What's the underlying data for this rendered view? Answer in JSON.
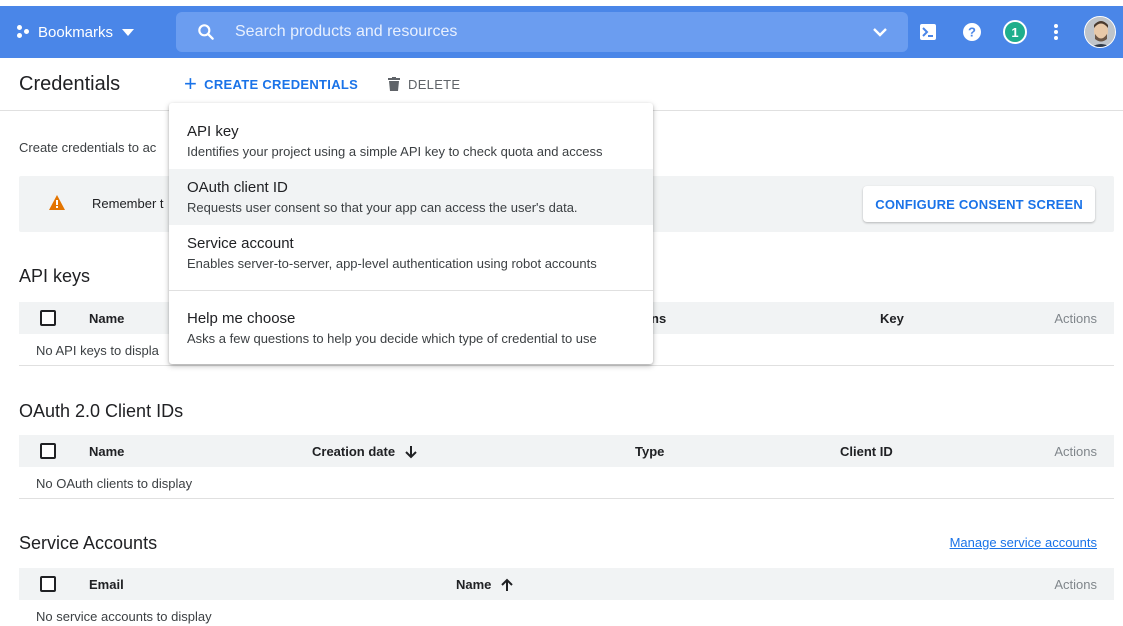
{
  "topbar": {
    "bookmarks_label": "Bookmarks",
    "search_placeholder": "Search products and resources",
    "notification_count": "1",
    "brand_color": "#4a86e8"
  },
  "page": {
    "title": "Credentials",
    "create_label": "CREATE CREDENTIALS",
    "delete_label": "DELETE",
    "intro_text": "Create credentials to ac",
    "notice_text": "Remember t",
    "consent_button": "CONFIGURE CONSENT SCREEN"
  },
  "menu": {
    "items": [
      {
        "title": "API key",
        "description": "Identifies your project using a simple API key to check quota and access"
      },
      {
        "title": "OAuth client ID",
        "description": "Requests user consent so that your app can access the user's data."
      },
      {
        "title": "Service account",
        "description": "Enables server-to-server, app-level authentication using robot accounts"
      },
      {
        "title": "Help me choose",
        "description": "Asks a few questions to help you decide which type of credential to use"
      }
    ]
  },
  "api_keys": {
    "title": "API keys",
    "columns": {
      "name": "Name",
      "restrictions_partial": "ns",
      "key": "Key",
      "actions": "Actions"
    },
    "empty": "No API keys to displa"
  },
  "oauth": {
    "title": "OAuth 2.0 Client IDs",
    "columns": {
      "name": "Name",
      "creation_date": "Creation date",
      "type": "Type",
      "client_id": "Client ID",
      "actions": "Actions"
    },
    "empty": "No OAuth clients to display"
  },
  "service_accounts": {
    "title": "Service Accounts",
    "manage_link": "Manage service accounts",
    "columns": {
      "email": "Email",
      "name": "Name",
      "actions": "Actions"
    },
    "empty": "No service accounts to display"
  }
}
